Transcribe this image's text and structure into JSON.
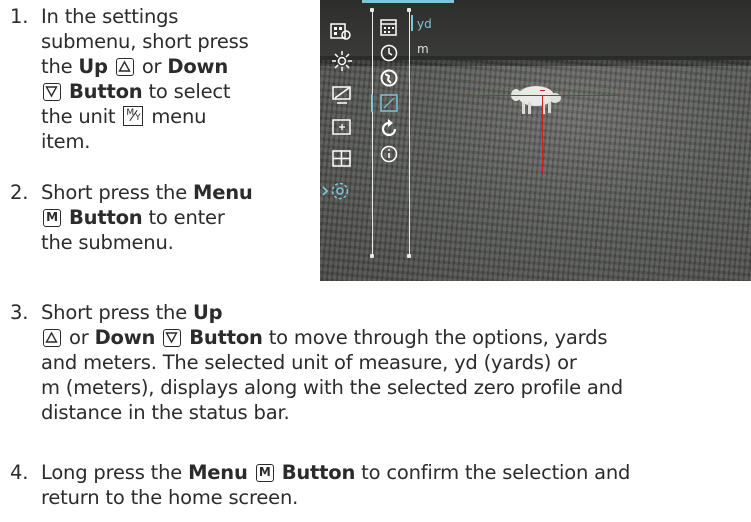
{
  "steps": [
    {
      "number": "1.",
      "lines": [
        "In the settings",
        "submenu, short press",
        "the",
        "or",
        "to select",
        "the unit",
        "menu",
        "item."
      ],
      "bold": [
        "Up",
        "Down",
        "Button"
      ]
    },
    {
      "number": "2.",
      "text_a": "Short press the",
      "bold_a": "Menu",
      "bold_b": "Button",
      "text_b": "to enter",
      "text_c": "the submenu."
    },
    {
      "number": "3.",
      "text_a": "Short press the",
      "bold_up": "Up",
      "text_or": "or",
      "bold_down": "Down",
      "bold_button": "Button",
      "text_b": "to move through the options, yards",
      "line3": "and meters. The selected unit of measure, yd (yards) or",
      "line4": "m (meters), displays along with the selected zero profile and",
      "line5": "distance in the status bar."
    },
    {
      "number": "4.",
      "text_a": "Long press the",
      "bold_menu": "Menu",
      "bold_button": "Button",
      "text_b": "to confirm the selection and",
      "line2": "return to the home screen."
    }
  ],
  "screen": {
    "unit_options": [
      "yd",
      "m"
    ],
    "selected_unit": "yd",
    "accent_color": "#7bc6d8",
    "reticle_color": "#d11d1d",
    "menu_icons": [
      "video-mode-icon",
      "brightness-icon",
      "display-icon",
      "zoom-icon",
      "pip-icon",
      "settings-icon"
    ],
    "submenu_icons": [
      "calendar-icon",
      "clock-icon",
      "globe-icon",
      "unit-icon",
      "reset-icon",
      "info-icon"
    ]
  },
  "icons": {
    "up": "up-button-icon",
    "down": "down-button-icon",
    "menu": "menu-button-icon",
    "unit": "unit-icon",
    "menu_glyph": "M",
    "unit_top": "M",
    "unit_bottom": "Y"
  }
}
